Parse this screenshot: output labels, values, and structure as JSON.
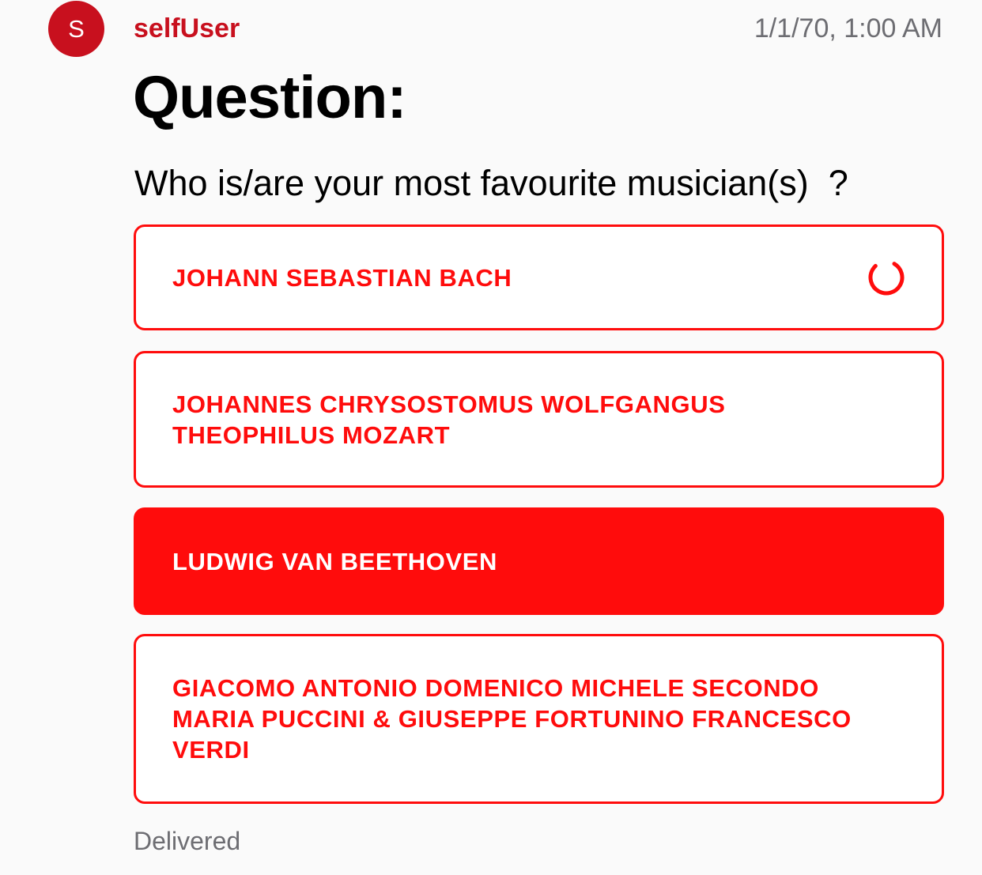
{
  "message": {
    "avatar_initial": "S",
    "sender": "selfUser",
    "timestamp": "1/1/70, 1:00 AM",
    "status": "Delivered"
  },
  "poll": {
    "heading": "Question:",
    "question": "Who is/are your most favourite musician(s)  ?",
    "options": [
      {
        "label": "JOHANN SEBASTIAN BACH",
        "selected": false,
        "loading": true
      },
      {
        "label": "JOHANNES CHRYSOSTOMUS WOLFGANGUS THEOPHILUS MOZART",
        "selected": false,
        "loading": false
      },
      {
        "label": "LUDWIG VAN BEETHOVEN",
        "selected": true,
        "loading": false
      },
      {
        "label": "GIACOMO ANTONIO DOMENICO MICHELE SECONDO MARIA PUCCINI & GIUSEPPE FORTUNINO FRANCESCO VERDI",
        "selected": false,
        "loading": false
      }
    ]
  },
  "icons": {
    "spinner": "loading-spinner-icon"
  },
  "colors": {
    "accent": "#ff0c0c",
    "avatar": "#c8101e",
    "secondary_text": "#6d6d72",
    "background": "#fafafa"
  }
}
